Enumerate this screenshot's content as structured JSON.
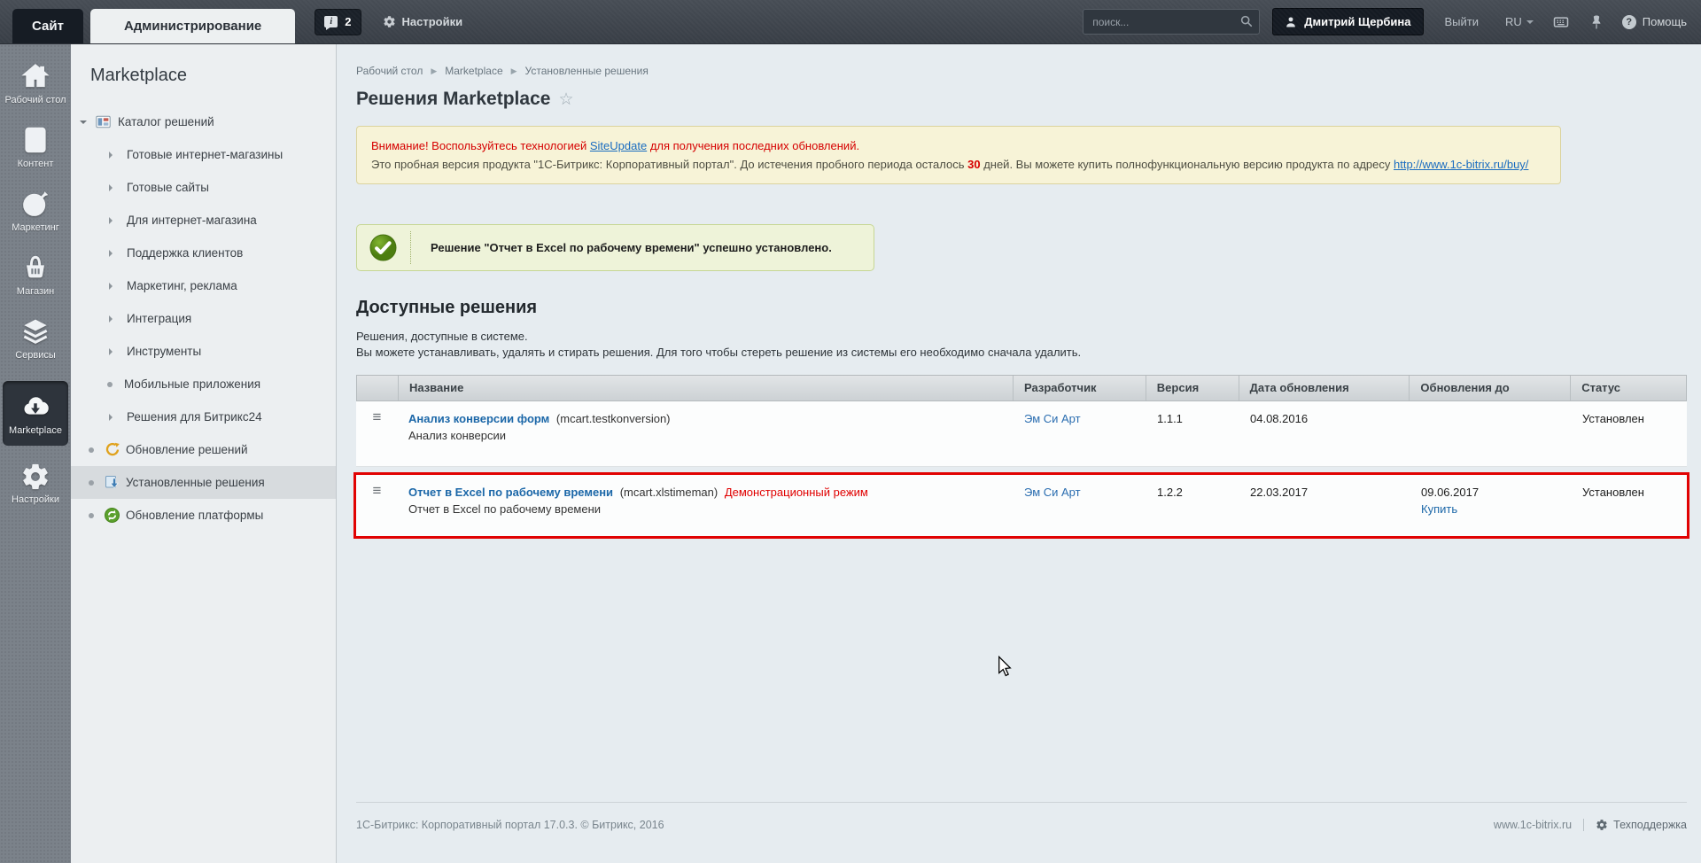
{
  "topbar": {
    "site_tab": "Сайт",
    "admin_tab": "Администрирование",
    "notifications_count": "2",
    "settings_label": "Настройки",
    "search_placeholder": "поиск...",
    "user_name": "Дмитрий Щербина",
    "logout_label": "Выйти",
    "lang_label": "RU",
    "help_label": "Помощь"
  },
  "rail": {
    "items": [
      {
        "label": "Рабочий стол",
        "icon": "home-icon"
      },
      {
        "label": "Контент",
        "icon": "document-icon"
      },
      {
        "label": "Маркетинг",
        "icon": "target-icon"
      },
      {
        "label": "Магазин",
        "icon": "basket-icon"
      },
      {
        "label": "Сервисы",
        "icon": "layers-icon"
      },
      {
        "label": "Marketplace",
        "icon": "cloud-download-icon",
        "selected": true
      },
      {
        "label": "Настройки",
        "icon": "gear-icon"
      }
    ]
  },
  "menu": {
    "title": "Marketplace",
    "items": [
      {
        "label": "Каталог решений",
        "expanded": true
      },
      {
        "label": "Готовые интернет-магазины"
      },
      {
        "label": "Готовые сайты"
      },
      {
        "label": "Для интернет-магазина"
      },
      {
        "label": "Поддержка клиентов"
      },
      {
        "label": "Маркетинг, реклама"
      },
      {
        "label": "Интеграция"
      },
      {
        "label": "Инструменты"
      },
      {
        "label": "Мобильные приложения"
      },
      {
        "label": "Решения для Битрикс24"
      },
      {
        "label": "Обновление решений"
      },
      {
        "label": "Установленные решения",
        "selected": true
      },
      {
        "label": "Обновление платформы"
      }
    ]
  },
  "breadcrumb": {
    "items": [
      "Рабочий стол",
      "Marketplace",
      "Установленные решения"
    ]
  },
  "page": {
    "title": "Решения Marketplace"
  },
  "notice": {
    "line1_prefix": "Внимание! Воспользуйтесь технологией ",
    "line1_link": "SiteUpdate",
    "line1_suffix": " для получения последних обновлений.",
    "line2_prefix": "Это пробная версия продукта \"1С-Битрикс: Корпоративный портал\". До истечения пробного периода осталось ",
    "line2_days": "30",
    "line2_mid": " дней. Вы можете купить полнофункциональную версию продукта по адресу ",
    "line2_link": "http://www.1c-bitrix.ru/buy/"
  },
  "success": {
    "message": "Решение \"Отчет в Excel по рабочему времени\" успешно установлено."
  },
  "section": {
    "title": "Доступные решения",
    "desc1": "Решения, доступные в системе.",
    "desc2": "Вы можете устанавливать, удалять и стирать решения. Для того чтобы стереть решение из системы его необходимо сначала удалить."
  },
  "table": {
    "headers": [
      "Название",
      "Разработчик",
      "Версия",
      "Дата обновления",
      "Обновления до",
      "Статус"
    ],
    "rows": [
      {
        "name": "Анализ конверсии форм",
        "code": "(mcart.testkonversion)",
        "subtitle": "Анализ конверсии",
        "developer": "Эм Си Арт",
        "version": "1.1.1",
        "updated": "04.08.2016",
        "updates_until": "",
        "buy": "",
        "status": "Установлен",
        "highlighted": false
      },
      {
        "name": "Отчет в Excel по рабочему времени",
        "code": "(mcart.xlstimeman)",
        "demo": "Демонстрационный режим",
        "subtitle": "Отчет в Excel по рабочему времени",
        "developer": "Эм Си Арт",
        "version": "1.2.2",
        "updated": "22.03.2017",
        "updates_until": "09.06.2017",
        "buy": "Купить",
        "status": "Установлен",
        "highlighted": true
      }
    ]
  },
  "footer": {
    "copyright": "1С-Битрикс: Корпоративный портал 17.0.3. © Битрикс, 2016",
    "site_link": "www.1c-bitrix.ru",
    "support_label": "Техподдержка"
  },
  "colors": {
    "accent_red": "#e10202",
    "link_blue": "#1b67a8",
    "warning_bg": "#f7f3d7",
    "success_green": "#5f9a1d",
    "success_bg": "#eef3d9",
    "topbar_bg": "#3e444c",
    "rail_bg": "#7b828a",
    "selected_menu_bg": "#d7dbde"
  }
}
